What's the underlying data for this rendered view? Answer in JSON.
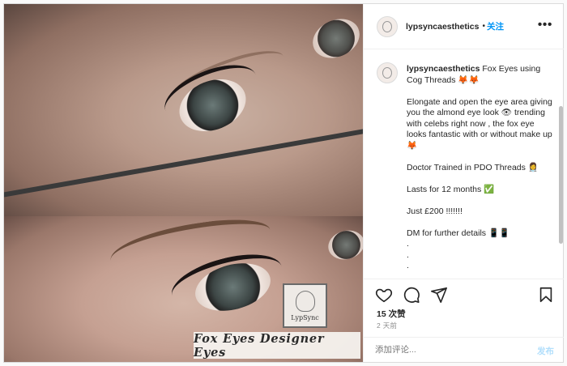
{
  "post": {
    "username": "lypsyncaesthetics",
    "follow_dot": "•",
    "follow_label": "关注",
    "more_label": "•••",
    "media": {
      "logo_text": "LypSync",
      "banner_text": "Fox Eyes Designer Eyes"
    },
    "caption": {
      "username": "lypsyncaesthetics",
      "lines": [
        "Fox Eyes using Cog Threads 🦊🦊",
        "",
        "Elongate and open the eye area giving you the almond eye look 👁 trending with celebs right now , the fox eye looks fantastic with or without make up 🦊",
        "",
        "Doctor Trained in PDO Threads 👩‍⚕️",
        "",
        "Lasts for 12 months ✅",
        "",
        "Just £200 !!!!!!!",
        "",
        "DM for further details 📱📱",
        ".",
        ".",
        "."
      ]
    },
    "actions": {
      "like_icon": "heart-icon",
      "comment_icon": "comment-icon",
      "share_icon": "share-icon",
      "save_icon": "bookmark-icon"
    },
    "likes_text": "15 次赞",
    "time_text": "2 天前",
    "comment_placeholder": "添加评论...",
    "post_label": "发布"
  }
}
